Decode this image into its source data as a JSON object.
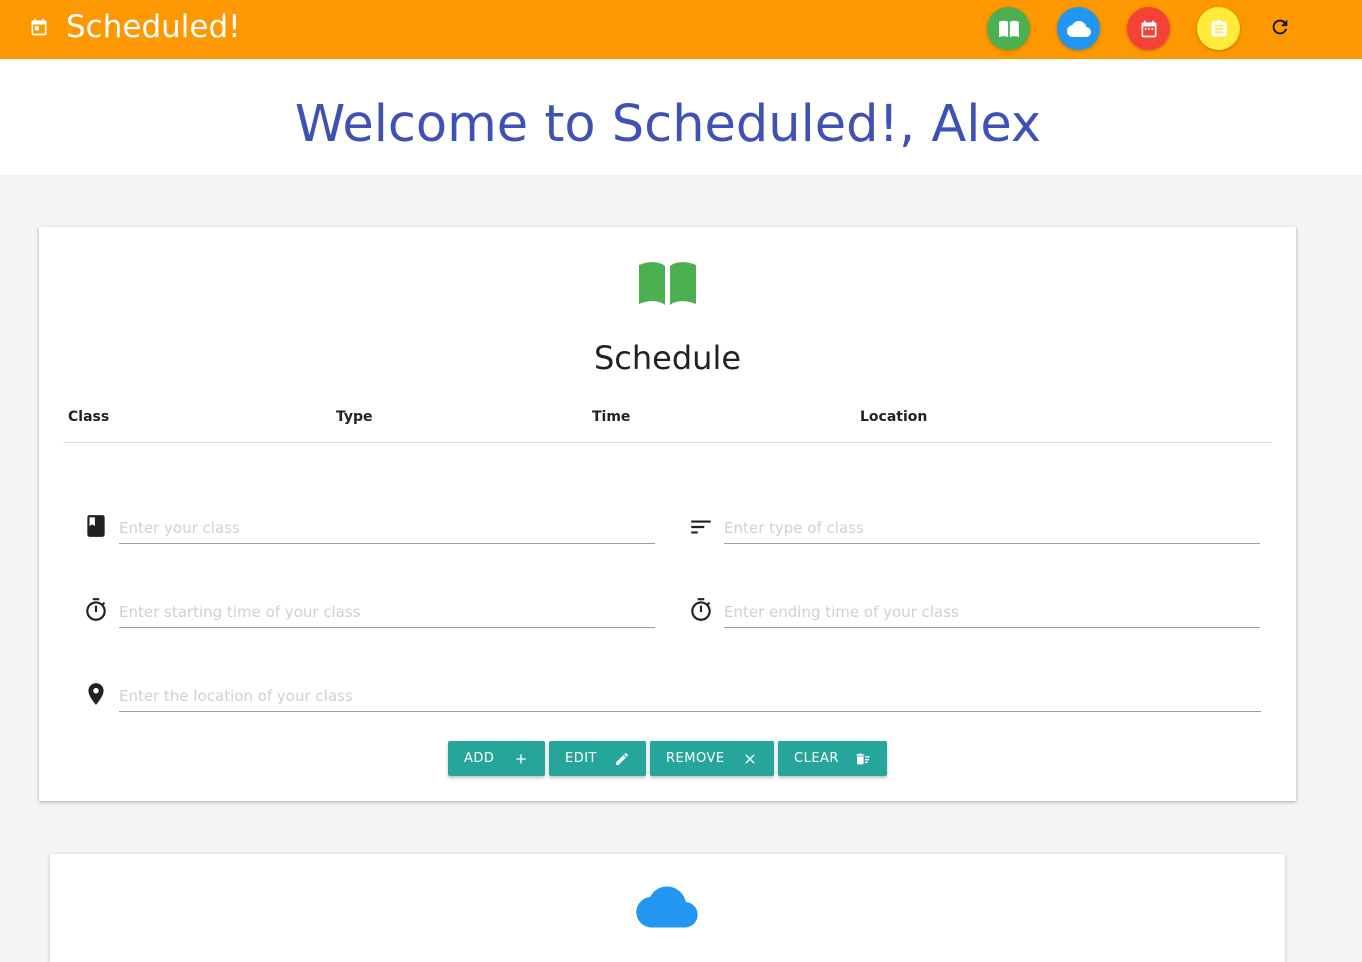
{
  "app": {
    "title": "Scheduled!",
    "accent_color": "#fe9800",
    "icon": "calendar-icon"
  },
  "nav": {
    "buttons": [
      {
        "icon": "book-icon",
        "color": "#4caf50"
      },
      {
        "icon": "cloud-icon",
        "color": "#2196f3"
      },
      {
        "icon": "calendar-icon",
        "color": "#f44336"
      },
      {
        "icon": "clipboard-icon",
        "color": "#ffeb3b"
      }
    ],
    "refresh_icon": "refresh-icon"
  },
  "welcome": {
    "title": "Welcome to Scheduled!, Alex",
    "color": "#3f51b5"
  },
  "schedule": {
    "title": "Schedule",
    "icon": "book-icon",
    "icon_color": "#4caf50",
    "columns": [
      "Class",
      "Type",
      "Time",
      "Location"
    ],
    "rows": [],
    "fields": {
      "class_placeholder": "Enter your class",
      "type_placeholder": "Enter type of class",
      "start_placeholder": "Enter starting time of your class",
      "end_placeholder": "Enter ending time of your class",
      "location_placeholder": "Enter the location of your class"
    },
    "buttons": {
      "add": "ADD",
      "edit": "EDIT",
      "remove": "REMOVE",
      "clear": "CLEAR",
      "color": "#26a69a"
    }
  },
  "weather": {
    "icon": "cloud-icon",
    "icon_color": "#2196f3"
  }
}
